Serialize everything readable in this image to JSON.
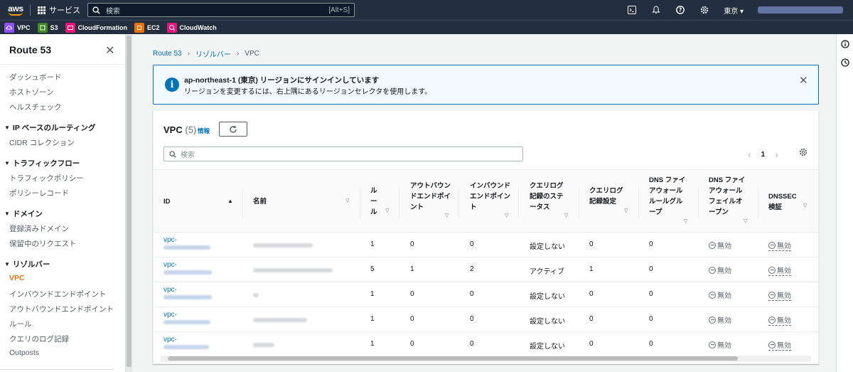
{
  "topnav": {
    "logo": "aws",
    "services_label": "サービス",
    "search_placeholder": "検索",
    "search_shortcut": "[Alt+S]",
    "region": "東京 ▾"
  },
  "favorites": [
    {
      "label": "VPC",
      "color": "#8c4fff"
    },
    {
      "label": "S3",
      "color": "#3f8624"
    },
    {
      "label": "CloudFormation",
      "color": "#e7157b"
    },
    {
      "label": "EC2",
      "color": "#ed7100"
    },
    {
      "label": "CloudWatch",
      "color": "#e7157b"
    }
  ],
  "sidebar": {
    "title": "Route 53",
    "items": {
      "dashboard": "ダッシュボード",
      "hosted_zones": "ホストゾーン",
      "health_checks": "ヘルスチェック",
      "ip_routing": "IP ベースのルーティング",
      "cidr": "CIDR コレクション",
      "traffic_flow": "トラフィックフロー",
      "traffic_policy": "トラフィックポリシー",
      "policy_record": "ポリシーレコード",
      "domains": "ドメイン",
      "registered": "登録済みドメイン",
      "pending": "保留中のリクエスト",
      "resolver": "リゾルバー",
      "vpc": "VPC",
      "inbound": "インバウンドエンドポイント",
      "outbound": "アウトバウンドエンドポイント",
      "rules": "ルール",
      "query_logging": "クエリのログ記録",
      "outposts": "Outposts"
    }
  },
  "breadcrumb": {
    "route53": "Route 53",
    "resolver": "リゾルバー",
    "vpc": "VPC"
  },
  "flash": {
    "title": "ap-northeast-1 (東京) リージョンにサインインしています",
    "description": "リージョンを変更するには、右上隅にあるリージョンセレクタを使用します。"
  },
  "table": {
    "title": "VPC",
    "count": "(5)",
    "info": "情報",
    "search_placeholder": "検索",
    "page": "1",
    "headers": {
      "id": "ID",
      "name": "名前",
      "rules": "ルール",
      "outbound": "アウトバウンドエンドポイント",
      "inbound": "インバウンドエンドポイント",
      "query_status": "クエリログ記録のステータス",
      "query_config": "クエリログ記録設定",
      "dns_fw_group": "DNS ファイアウォールルールグループ",
      "dns_fw_failopen": "DNS ファイアウォールフェイルオープン",
      "dnssec": "DNSSEC 検証"
    },
    "rows": [
      {
        "id": "vpc-",
        "rules": "1",
        "outbound": "0",
        "inbound": "0",
        "status": "設定しない",
        "config": "0",
        "fw_group": "0",
        "failopen": "無効",
        "dnssec": "無効"
      },
      {
        "id": "vpc-",
        "rules": "5",
        "outbound": "1",
        "inbound": "2",
        "status": "アクティブ",
        "config": "1",
        "fw_group": "0",
        "failopen": "無効",
        "dnssec": "無効"
      },
      {
        "id": "vpc-",
        "rules": "1",
        "outbound": "0",
        "inbound": "0",
        "status": "設定しない",
        "config": "0",
        "fw_group": "0",
        "failopen": "無効",
        "dnssec": "無効"
      },
      {
        "id": "vpc-",
        "rules": "1",
        "outbound": "0",
        "inbound": "0",
        "status": "設定しない",
        "config": "0",
        "fw_group": "0",
        "failopen": "無効",
        "dnssec": "無効"
      },
      {
        "id": "vpc-",
        "rules": "1",
        "outbound": "0",
        "inbound": "0",
        "status": "設定しない",
        "config": "0",
        "fw_group": "0",
        "failopen": "無効",
        "dnssec": "無効"
      }
    ]
  }
}
